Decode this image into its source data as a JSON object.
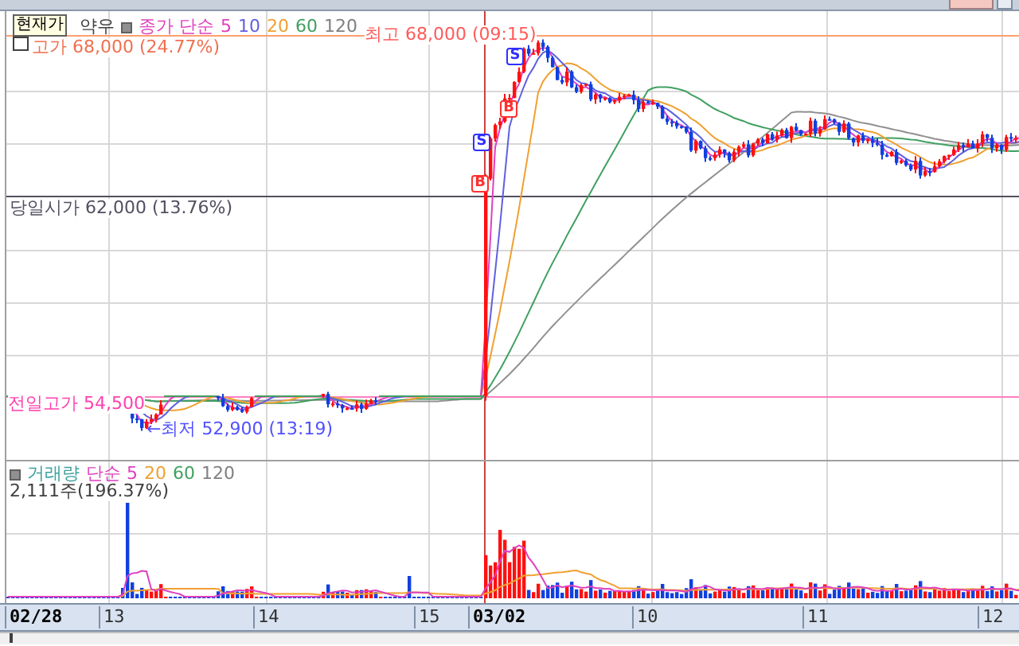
{
  "price_pane": {
    "tooltip": "현재가",
    "item_name": "약우",
    "legend": [
      {
        "text": "종가 단순",
        "color": "#e040c0"
      },
      {
        "text": "5",
        "color": "#e040c0"
      },
      {
        "text": "10",
        "color": "#6060e0"
      },
      {
        "text": "20",
        "color": "#f0a030"
      },
      {
        "text": "60",
        "color": "#40a060"
      },
      {
        "text": "120",
        "color": "#808080"
      }
    ],
    "high_price": "고가 68,000 (24.77%)",
    "high_mark": "최고 68,000 (09:15)",
    "open_price": "당일시가 62,000 (13.76%)",
    "prev_high": "전일고가 54,500",
    "low_mark": "←최저 52,900 (13:19)",
    "trade_markers": [
      {
        "label": "B",
        "kind": "buy"
      },
      {
        "label": "S",
        "kind": "sell"
      },
      {
        "label": "B",
        "kind": "buy"
      },
      {
        "label": "S",
        "kind": "sell"
      }
    ]
  },
  "volume_pane": {
    "legend": [
      {
        "text": "거래량",
        "color": "#40a0a0"
      },
      {
        "text": "단순 5",
        "color": "#e040c0"
      },
      {
        "text": "20",
        "color": "#f0a030"
      },
      {
        "text": "60",
        "color": "#40a060"
      },
      {
        "text": "120",
        "color": "#808080"
      }
    ],
    "reading": "2,111주(196.37%)"
  },
  "x_axis": [
    {
      "text": "02/28",
      "kind": "month"
    },
    {
      "text": "13",
      "kind": "day"
    },
    {
      "text": "14",
      "kind": "day"
    },
    {
      "text": "15",
      "kind": "day"
    },
    {
      "text": "03/02",
      "kind": "month"
    },
    {
      "text": "10",
      "kind": "day"
    },
    {
      "text": "11",
      "kind": "day"
    },
    {
      "text": "12",
      "kind": "day"
    }
  ]
}
